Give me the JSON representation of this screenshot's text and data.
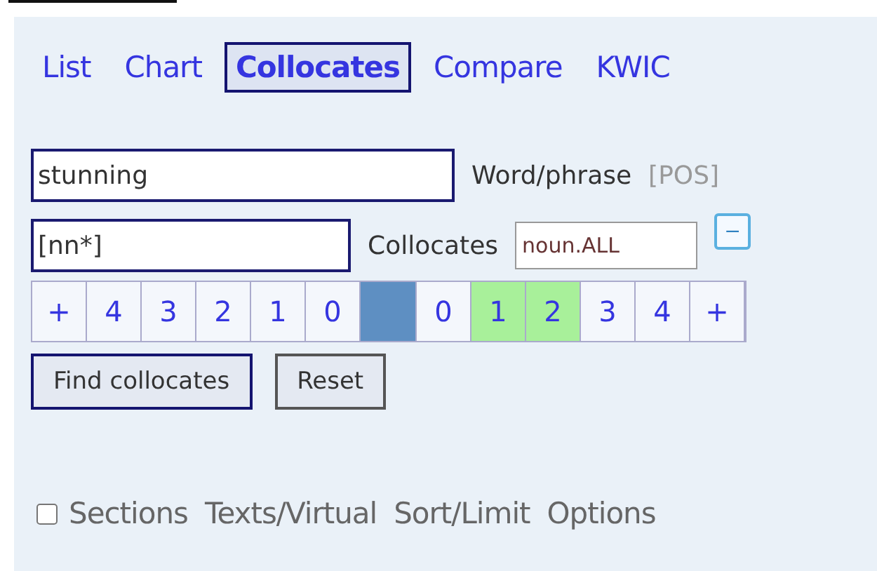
{
  "tabs": [
    {
      "label": "List",
      "selected": false
    },
    {
      "label": "Chart",
      "selected": false
    },
    {
      "label": "Collocates",
      "selected": true
    },
    {
      "label": "Compare",
      "selected": false
    },
    {
      "label": "KWIC",
      "selected": false
    }
  ],
  "word_field": {
    "value": "stunning",
    "label": "Word/phrase",
    "pos_link": "[POS]"
  },
  "collocates_field": {
    "value": "[nn*]",
    "label": "Collocates",
    "pos_value": "noun.ALL",
    "toggle": "–"
  },
  "span": [
    {
      "kind": "cell",
      "label": "+",
      "selected": false
    },
    {
      "kind": "cell",
      "label": "4",
      "selected": false
    },
    {
      "kind": "cell",
      "label": "3",
      "selected": false
    },
    {
      "kind": "cell",
      "label": "2",
      "selected": false
    },
    {
      "kind": "cell",
      "label": "1",
      "selected": false
    },
    {
      "kind": "cell",
      "label": "0",
      "selected": false
    },
    {
      "kind": "node"
    },
    {
      "kind": "cell",
      "label": "0",
      "selected": false
    },
    {
      "kind": "cell",
      "label": "1",
      "selected": true
    },
    {
      "kind": "cell",
      "label": "2",
      "selected": true
    },
    {
      "kind": "cell",
      "label": "3",
      "selected": false
    },
    {
      "kind": "cell",
      "label": "4",
      "selected": false
    },
    {
      "kind": "cell",
      "label": "+",
      "selected": false
    }
  ],
  "buttons": [
    {
      "label": "Find collocates",
      "primary": true
    },
    {
      "label": "Reset",
      "primary": false
    }
  ],
  "sections": {
    "checked": false,
    "label": "Sections",
    "links": [
      "Texts/Virtual",
      "Sort/Limit",
      "Options"
    ]
  }
}
